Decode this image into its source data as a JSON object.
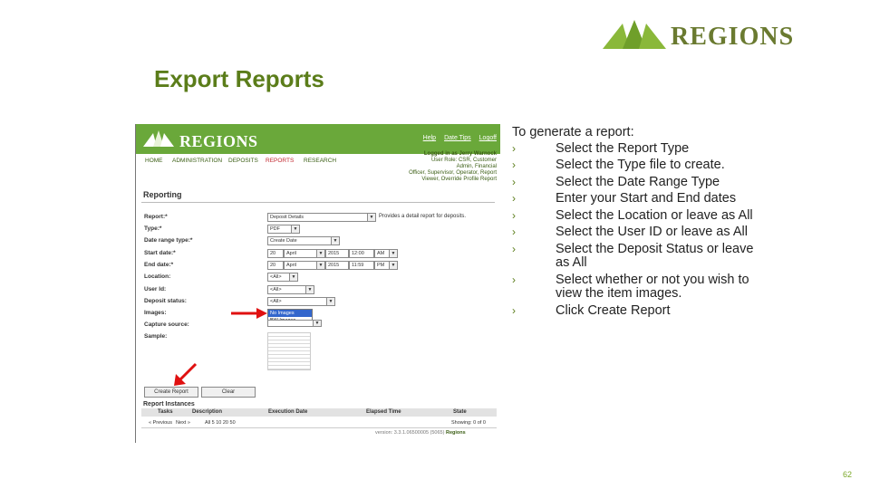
{
  "slide": {
    "title": "Export Reports",
    "page_number": "62",
    "logo_text": "REGIONS",
    "accent_color": "#5b7d1a"
  },
  "screenshot": {
    "logo_text": "REGIONS",
    "top_links": [
      "Help",
      "Date Tips",
      "Logoff"
    ],
    "nav": [
      "HOME",
      "ADMINISTRATION",
      "DEPOSITS",
      "REPORTS",
      "RESEARCH"
    ],
    "active_nav": "REPORTS",
    "user_info": [
      "Logged in as Jerry Warnock",
      "User Role: CSR, Customer",
      "Admin, Financial",
      "Officer, Supervisor, Operator, Report",
      "Viewer, Override Profile Report"
    ],
    "section_title": "Reporting",
    "form": {
      "report_label": "Report:*",
      "report_value": "Deposit Details",
      "report_hint": "Provides a detail report for deposits.",
      "type_label": "Type:*",
      "type_value": "PDF",
      "date_range_label": "Date range type:*",
      "date_range_value": "Create Date",
      "start_label": "Start date:*",
      "start_day": "20",
      "start_month": "April",
      "start_year": "2015",
      "start_time": "12:00",
      "start_ampm": "AM",
      "end_label": "End date:*",
      "end_day": "20",
      "end_month": "April",
      "end_year": "2015",
      "end_time": "11:59",
      "end_ampm": "PM",
      "location_label": "Location:",
      "location_value": "<All>",
      "user_label": "User Id:",
      "user_value": "<All>",
      "status_label": "Deposit status:",
      "status_value": "<All>",
      "images_label": "Images:",
      "images_options": [
        "No Images",
        "BW Images"
      ],
      "capture_label": "Capture source:",
      "sample_label": "Sample:"
    },
    "buttons": {
      "create": "Create Report",
      "clear": "Clear"
    },
    "report_instances": {
      "title": "Report Instances",
      "columns": [
        "Tasks",
        "Description",
        "Execution Date",
        "Elapsed Time",
        "State"
      ],
      "pager_prev": "« Previous",
      "pager_next": "Next »",
      "row_text": "All 5 10 20 50",
      "showing": "Showing: 0 of 0"
    },
    "version_text": "version: 3.3.1.06500005 (5065)",
    "version_brand": "Regions"
  },
  "instructions": {
    "intro": "To generate a report:",
    "steps": [
      "Select the Report Type",
      "Select the Type file to create.",
      "Select the Date Range Type",
      "Enter your Start and End dates",
      "Select the Location or leave as All",
      "Select the User ID or leave as All",
      "Select the Deposit Status or leave as All",
      "Select whether or not you wish to view the item images."
    ],
    "last_step_prefix": "Click",
    "last_step_bold": "Create Report"
  }
}
